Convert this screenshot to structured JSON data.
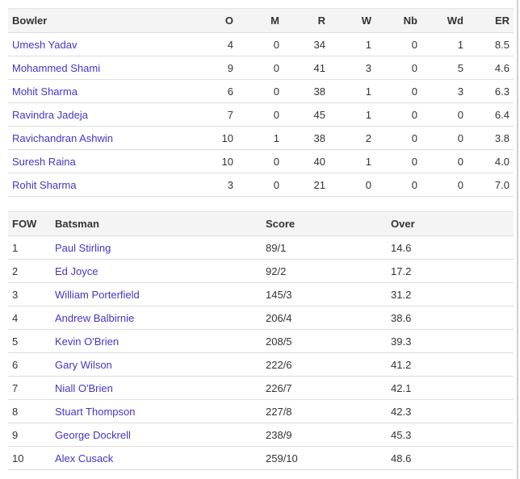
{
  "bowling": {
    "headers": [
      "Bowler",
      "O",
      "M",
      "R",
      "W",
      "Nb",
      "Wd",
      "ER"
    ],
    "rows": [
      [
        "Umesh Yadav",
        "4",
        "0",
        "34",
        "1",
        "0",
        "1",
        "8.5"
      ],
      [
        "Mohammed Shami",
        "9",
        "0",
        "41",
        "3",
        "0",
        "5",
        "4.6"
      ],
      [
        "Mohit Sharma",
        "6",
        "0",
        "38",
        "1",
        "0",
        "3",
        "6.3"
      ],
      [
        "Ravindra Jadeja",
        "7",
        "0",
        "45",
        "1",
        "0",
        "0",
        "6.4"
      ],
      [
        "Ravichandran Ashwin",
        "10",
        "1",
        "38",
        "2",
        "0",
        "0",
        "3.8"
      ],
      [
        "Suresh Raina",
        "10",
        "0",
        "40",
        "1",
        "0",
        "0",
        "4.0"
      ],
      [
        "Rohit Sharma",
        "3",
        "0",
        "21",
        "0",
        "0",
        "0",
        "7.0"
      ]
    ]
  },
  "fow": {
    "headers": [
      "FOW",
      "Batsman",
      "Score",
      "Over"
    ],
    "rows": [
      [
        "1",
        "Paul Stirling",
        "89/1",
        "14.6"
      ],
      [
        "2",
        "Ed Joyce",
        "92/2",
        "17.2"
      ],
      [
        "3",
        "William Porterfield",
        "145/3",
        "31.2"
      ],
      [
        "4",
        "Andrew Balbirnie",
        "206/4",
        "38.6"
      ],
      [
        "5",
        "Kevin O'Brien",
        "208/5",
        "39.3"
      ],
      [
        "6",
        "Gary Wilson",
        "222/6",
        "41.2"
      ],
      [
        "7",
        "Niall O'Brien",
        "226/7",
        "42.1"
      ],
      [
        "8",
        "Stuart Thompson",
        "227/8",
        "42.3"
      ],
      [
        "9",
        "George Dockrell",
        "238/9",
        "45.3"
      ],
      [
        "10",
        "Alex Cusack",
        "259/10",
        "48.6"
      ]
    ]
  },
  "colors": {
    "link": "#4236c4",
    "header_bg": "#f4f4f4"
  }
}
